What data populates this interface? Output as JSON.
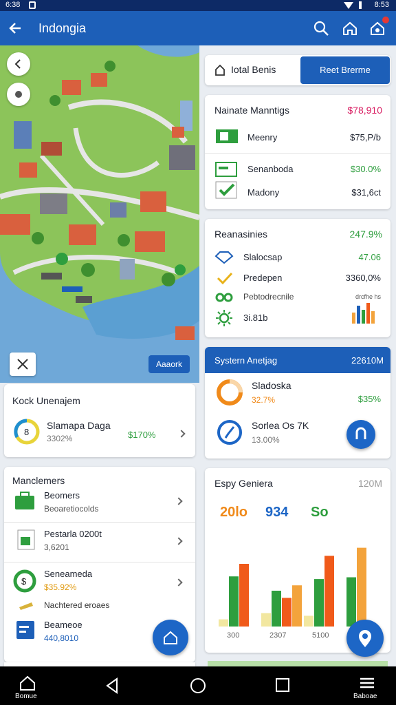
{
  "status": {
    "time": "6:38",
    "right": "8:53"
  },
  "appbar": {
    "title": "Indongia"
  },
  "map": {
    "pill_label": "Aaaork"
  },
  "left_card1": {
    "title": "Kock Unenajem",
    "item_icon": "8",
    "item_title": "Slamapa Daga",
    "item_sub": "3302%",
    "item_value": "$170%"
  },
  "left_card2": {
    "title": "Manclemers",
    "items": [
      {
        "title": "Beomers",
        "sub": "Beoaretiocolds"
      },
      {
        "title": "Pestarla 0200t",
        "sub": "3,6201"
      },
      {
        "title": "Seneameda",
        "sub": "$35.92%"
      },
      {
        "title": "Nachtered eroaes",
        "sub": ""
      },
      {
        "title": "Beameoe",
        "sub": "440,8010"
      }
    ]
  },
  "tabs": {
    "tab1": "Iotal Benis",
    "tab2": "Reet Brerme"
  },
  "card_money": {
    "title": "Nainate Manntigs",
    "title_value": "$78,910",
    "rows": [
      {
        "label": "Meenry",
        "value": "$75,P/b"
      },
      {
        "label": "Senanboda",
        "value": "$30.0%"
      },
      {
        "label": "Madony",
        "value": "$31,6ct"
      }
    ]
  },
  "card_stats": {
    "title": "Reanasinies",
    "title_value": "247.9%",
    "rows": [
      {
        "label": "Slalocsap",
        "value": "47.06"
      },
      {
        "label": "Predepen",
        "value": "3360,0%"
      },
      {
        "label": "Pebtodrecnile",
        "value": "drcfhe hs"
      },
      {
        "label": "3i.81b",
        "value": ""
      }
    ]
  },
  "card_system": {
    "title": "Systern Anetjag",
    "title_value": "22610M",
    "rows": [
      {
        "label": "Sladoska",
        "sub": "32.7%",
        "value": "$35%"
      },
      {
        "label": "Sorlea Os 7K",
        "sub": "13.00%",
        "value": ""
      }
    ]
  },
  "chart_card": {
    "title": "Espy Geniera",
    "title_right": "120M"
  },
  "chart_data": {
    "type": "bar",
    "header_values": [
      "20lo",
      "934",
      "So"
    ],
    "categories": [
      "300",
      "2307",
      "5100",
      ""
    ],
    "series": [
      {
        "values": [
          8,
          15,
          12,
          0
        ]
      },
      {
        "values": [
          56,
          40,
          53,
          55
        ]
      },
      {
        "values": [
          70,
          32,
          79,
          0
        ]
      },
      {
        "values": [
          0,
          46,
          0,
          88
        ]
      }
    ],
    "colors": [
      "#f2e7a0",
      "#2e9e3e",
      "#f05a1a",
      "#f3a33c"
    ],
    "ylim": [
      0,
      100
    ]
  },
  "bottomnav": {
    "home": "Bomue",
    "menu": "Baboae"
  },
  "colors": {
    "primary": "#1d5fb8",
    "green": "#2e9e3e",
    "pink": "#d81b60",
    "orange": "#f08a1a"
  }
}
